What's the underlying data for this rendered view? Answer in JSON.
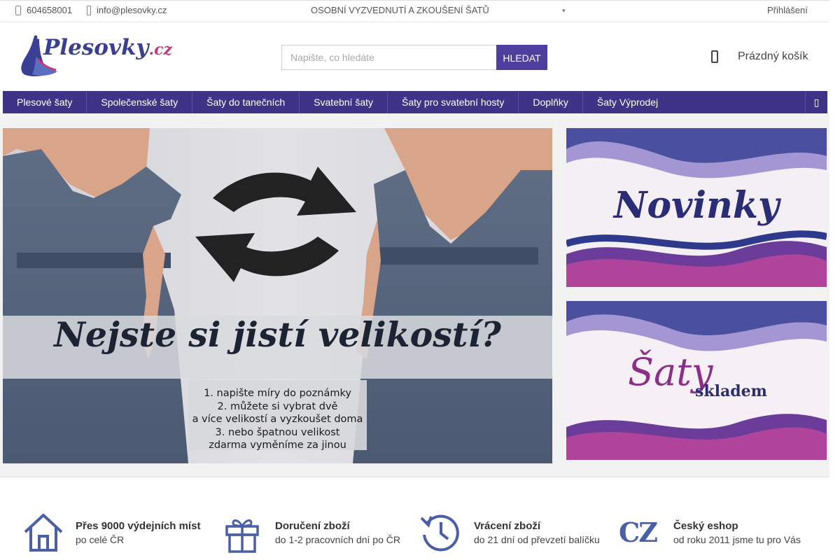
{
  "topbar": {
    "phone": "604658001",
    "email": "info@plesovky.cz",
    "promo": "OSOBNÍ VYZVEDNUTÍ A ZKOUŠENÍ ŠATŮ",
    "login": "Přihlášení",
    "phone_icon": "phone-icon",
    "email_icon": "envelope-icon"
  },
  "header": {
    "logo_text": "Plesovky",
    "logo_tld": ".cz",
    "search_placeholder": "Napište, co hledáte",
    "search_button": "HLEDAT",
    "cart_label": "Prázdný košík",
    "cart_icon": "cart-icon"
  },
  "nav": {
    "items": [
      {
        "label": "Plesové šaty"
      },
      {
        "label": "Společenské šaty"
      },
      {
        "label": "Šaty do tanečních"
      },
      {
        "label": "Svatební šaty"
      },
      {
        "label": "Šaty pro svatební hosty"
      },
      {
        "label": "Doplňky"
      },
      {
        "label": "Šaty Výprodej"
      }
    ]
  },
  "hero": {
    "title": "Nejste si jistí velikostí?",
    "lines": [
      "1. napište míry do poznámky",
      "2. můžete si vybrat dvě",
      "a více velikostí a vyzkoušet doma",
      "3. nebo špatnou velikost",
      "zdarma vyměníme za jinou"
    ]
  },
  "promos": {
    "novinky": "Novinky",
    "saty": "Šaty",
    "skladem": "skladem"
  },
  "features": [
    {
      "icon": "house-icon",
      "title": "Přes 9000 výdejních míst",
      "sub": "po celé ČR"
    },
    {
      "icon": "gift-icon",
      "title": "Doručení zboží",
      "sub": "do 1-2 pracovních dní po ČR"
    },
    {
      "icon": "clock-history-icon",
      "title": "Vrácení zboží",
      "sub": "do 21 dní od převzetí balíčku"
    },
    {
      "icon": "cz-badge-icon",
      "icon_text": "CZ",
      "title": "Český eshop",
      "sub": "od roku 2011 jsme tu pro Vás"
    }
  ],
  "colors": {
    "nav_bg": "#3d3488",
    "search_button_bg": "#4e3f9f",
    "icon_blue": "#4a5fa6"
  }
}
